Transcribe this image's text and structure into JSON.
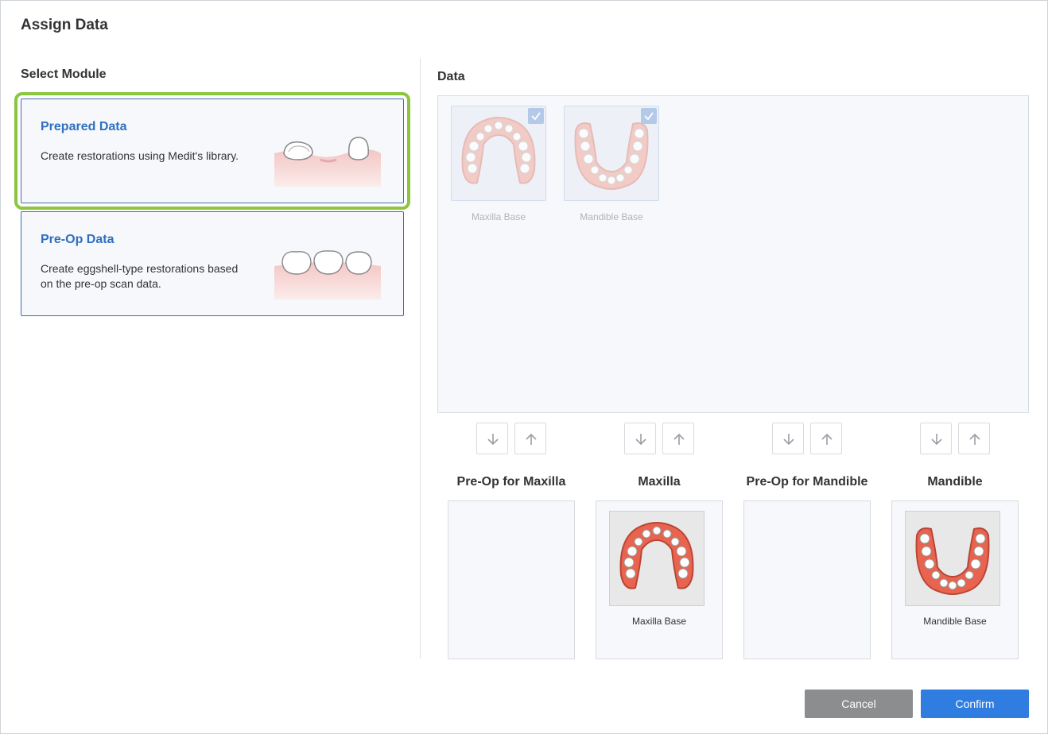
{
  "dialog": {
    "title": "Assign Data"
  },
  "left": {
    "section_label": "Select Module",
    "modules": [
      {
        "title": "Prepared Data",
        "description": "Create restorations using Medit's library.",
        "image_icon": "prepared-teeth-illustration"
      },
      {
        "title": "Pre-Op Data",
        "description": "Create eggshell-type restorations based on the pre-op scan data.",
        "image_icon": "preop-teeth-illustration"
      }
    ]
  },
  "right": {
    "section_label": "Data",
    "data_items": [
      {
        "label": "Maxilla Base",
        "checked": true
      },
      {
        "label": "Mandible Base",
        "checked": true
      }
    ],
    "slots": [
      {
        "title": "Pre-Op for Maxilla",
        "item_label": ""
      },
      {
        "title": "Maxilla",
        "item_label": "Maxilla Base"
      },
      {
        "title": "Pre-Op for Mandible",
        "item_label": ""
      },
      {
        "title": "Mandible",
        "item_label": "Mandible Base"
      }
    ]
  },
  "footer": {
    "cancel_label": "Cancel",
    "confirm_label": "Confirm"
  },
  "colors": {
    "accent": "#2f7de1",
    "selection_outline": "#8cc63f",
    "module_title": "#2f6fbf",
    "cancel_bg": "#8c8d8f"
  }
}
